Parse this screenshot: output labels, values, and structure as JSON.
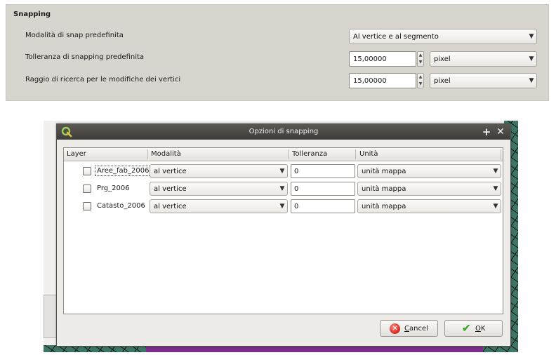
{
  "settings": {
    "title": "Snapping",
    "rows": [
      {
        "label": "Modalità di snap predefinita",
        "mode": "Al vertice e al segmento"
      },
      {
        "label": "Tolleranza di snapping predefinita",
        "value": "15,00000",
        "unit": "pixel"
      },
      {
        "label": "Raggio di ricerca per le modifiche dei vertici",
        "value": "15,00000",
        "unit": "pixel"
      }
    ]
  },
  "dialog": {
    "title": "Opzioni di snapping",
    "columns": [
      "Layer",
      "Modalità",
      "Tolleranza",
      "Unità"
    ],
    "rows": [
      {
        "layer": "Aree_fab_2006",
        "checked": false,
        "mode": "al vertice",
        "tolerance": "0",
        "unit": "unità mappa"
      },
      {
        "layer": "Prg_2006",
        "checked": false,
        "mode": "al vertice",
        "tolerance": "0",
        "unit": "unità mappa"
      },
      {
        "layer": "Catasto_2006",
        "checked": false,
        "mode": "al vertice",
        "tolerance": "0",
        "unit": "unità mappa"
      }
    ],
    "buttons": {
      "cancel": {
        "mnemonic": "C",
        "rest": "ancel"
      },
      "ok": {
        "mnemonic": "O",
        "rest": "K"
      }
    }
  },
  "icons": {
    "combo_arrow": "chevron-down-icon",
    "spin": "spin-up-down-icon",
    "titlebar": [
      "qgis-logo-icon",
      "plus-icon",
      "close-icon"
    ],
    "buttons": [
      "cancel-icon",
      "check-icon"
    ]
  },
  "colors": {
    "titlebar": "#4a4744",
    "panel": "#d8d4ce",
    "map": "#3f7566",
    "map_accent": "#7a2f8a"
  }
}
